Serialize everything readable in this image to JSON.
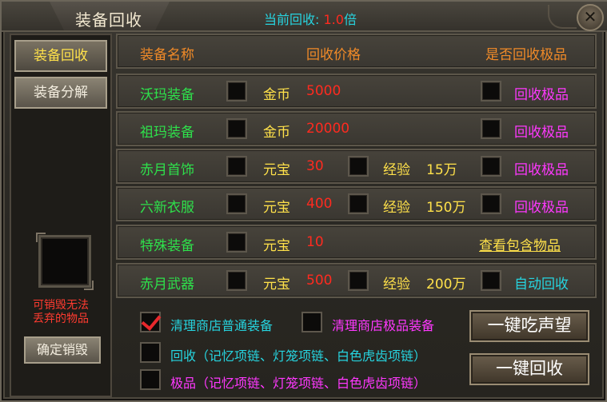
{
  "window": {
    "title": "装备回收",
    "rate_label": "当前回收:",
    "rate_value": "1.0",
    "rate_unit": "倍",
    "close": "✕"
  },
  "sidebar": {
    "tabs": [
      {
        "label": "装备回收",
        "active": true
      },
      {
        "label": "装备分解",
        "active": false
      }
    ],
    "warning_line1": "可销毁无法",
    "warning_line2": "丢弃的物品",
    "confirm_destroy": "确定销毁"
  },
  "table": {
    "headers": {
      "name": "装备名称",
      "price": "回收价格",
      "premium": "是否回收极品"
    },
    "rows": [
      {
        "name": "沃玛装备",
        "currency": "金币",
        "amount": "5000",
        "exp_label": "",
        "exp_value": "",
        "action": "回收极品",
        "action_type": "premium"
      },
      {
        "name": "祖玛装备",
        "currency": "金币",
        "amount": "20000",
        "exp_label": "",
        "exp_value": "",
        "action": "回收极品",
        "action_type": "premium"
      },
      {
        "name": "赤月首饰",
        "currency": "元宝",
        "amount": "30",
        "exp_label": "经验",
        "exp_value": "15万",
        "action": "回收极品",
        "action_type": "premium"
      },
      {
        "name": "六新衣服",
        "currency": "元宝",
        "amount": "400",
        "exp_label": "经验",
        "exp_value": "150万",
        "action": "回收极品",
        "action_type": "premium"
      },
      {
        "name": "特殊装备",
        "currency": "元宝",
        "amount": "10",
        "exp_label": "",
        "exp_value": "",
        "action": "查看包含物品",
        "action_type": "link"
      },
      {
        "name": "赤月武器",
        "currency": "元宝",
        "amount": "500",
        "exp_label": "经验",
        "exp_value": "200万",
        "action": "自动回收",
        "action_type": "auto"
      }
    ]
  },
  "options": {
    "clear_normal": "清理商店普通装备",
    "clear_normal_checked": true,
    "clear_premium": "清理商店极品装备",
    "recycle_list": "回收（记忆项链、灯笼项链、白色虎齿项链）",
    "premium_list": "极品（记忆项链、灯笼项链、白色虎齿项链）"
  },
  "buttons": {
    "fame": "一键吃声望",
    "recycle_all": "一键回收"
  }
}
